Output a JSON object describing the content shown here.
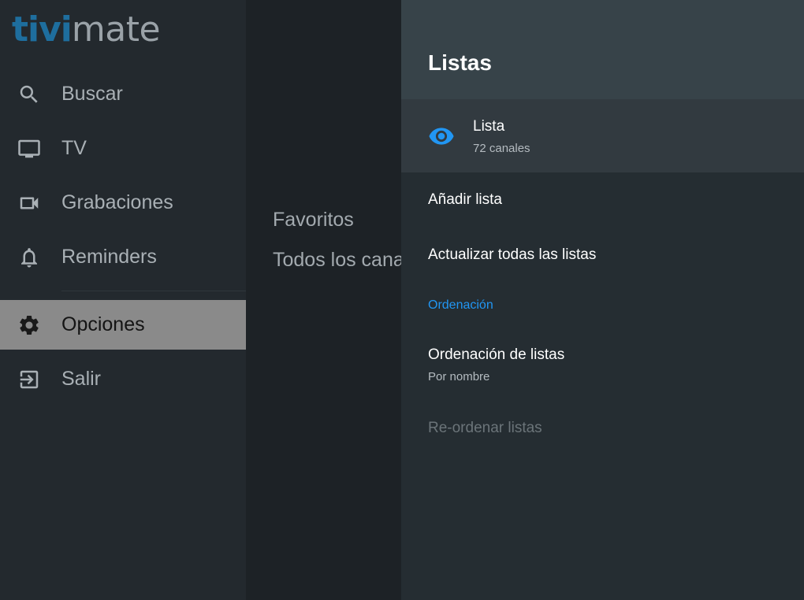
{
  "logo": {
    "part1": "tivi",
    "part2": "mate"
  },
  "sidebar": {
    "items": [
      {
        "label": "Buscar",
        "icon": "search-icon"
      },
      {
        "label": "TV",
        "icon": "tv-icon"
      },
      {
        "label": "Grabaciones",
        "icon": "videocam-icon"
      },
      {
        "label": "Reminders",
        "icon": "bell-icon"
      },
      {
        "label": "Opciones",
        "icon": "gear-icon",
        "active": true
      },
      {
        "label": "Salir",
        "icon": "exit-icon"
      }
    ]
  },
  "middle": {
    "categories": [
      "Favoritos",
      "Todos los canales"
    ]
  },
  "panel": {
    "title": "Listas",
    "playlist": {
      "name": "Lista",
      "channels": "72 canales",
      "icon": "eye-icon"
    },
    "add_list": "Añadir lista",
    "update_all": "Actualizar todas las listas",
    "section_sort": "Ordenación",
    "sort_lists": {
      "label": "Ordenación de listas",
      "value": "Por nombre"
    },
    "reorder_lists": "Re-ordenar listas"
  },
  "colors": {
    "accent": "#2196f3",
    "logo_blue": "#1e6e9e",
    "active_bg": "#8a8a8a"
  }
}
